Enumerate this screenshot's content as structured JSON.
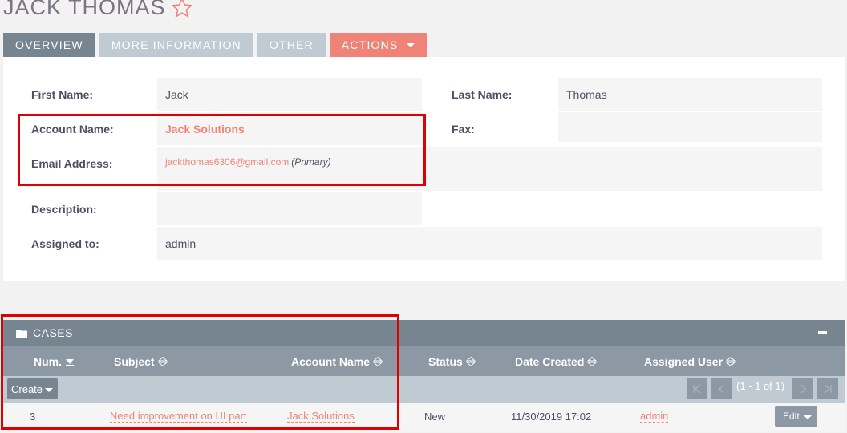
{
  "record": {
    "title": "JACK THOMAS"
  },
  "tabs": [
    {
      "label": "OVERVIEW"
    },
    {
      "label": "MORE INFORMATION"
    },
    {
      "label": "OTHER"
    },
    {
      "label": "ACTIONS"
    }
  ],
  "fields": {
    "first_name_label": "First Name:",
    "first_name": "Jack",
    "last_name_label": "Last Name:",
    "last_name": "Thomas",
    "account_name_label": "Account Name:",
    "account_name": "Jack Solutions",
    "fax_label": "Fax:",
    "fax": "",
    "email_label": "Email Address:",
    "email": "jackthomas6306@gmail.com",
    "email_tag": "(Primary)",
    "description_label": "Description:",
    "description": "",
    "assigned_label": "Assigned to:",
    "assigned_to": "admin"
  },
  "cases": {
    "title": "CASES",
    "columns": [
      "Num.",
      "Subject",
      "Account Name",
      "Status",
      "Date Created",
      "Assigned User"
    ],
    "create_label": "Create",
    "pagination": "(1 - 1 of 1)",
    "rows": [
      {
        "num": "3",
        "subject": "Need improvement on UI part",
        "account_name": "Jack Solutions",
        "status": "New",
        "date_created": "11/30/2019 17:02",
        "assigned_user": "admin",
        "edit_label": "Edit"
      }
    ]
  },
  "colors": {
    "accent": "#f08377",
    "header_dark": "#778591",
    "header_mid": "#8c98a3",
    "tab_inactive": "#bfcad3",
    "highlight_box": "#e00000"
  }
}
